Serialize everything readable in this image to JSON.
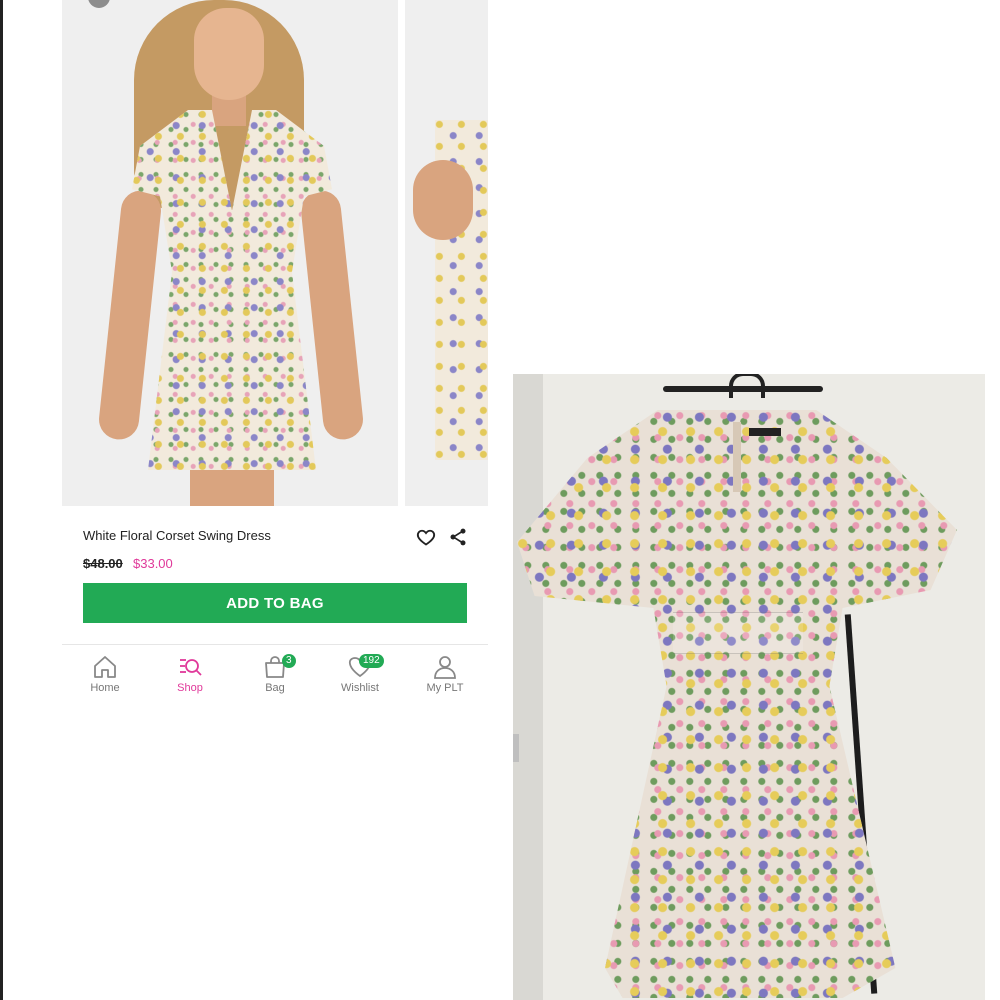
{
  "product": {
    "name": "White Floral Corset Swing Dress",
    "price_original": "$48.00",
    "price_sale": "$33.00",
    "add_to_bag_label": "ADD TO BAG"
  },
  "tabbar": {
    "tabs": [
      {
        "label": "Home",
        "icon": "home-icon"
      },
      {
        "label": "Shop",
        "icon": "shop-icon",
        "active": true
      },
      {
        "label": "Bag",
        "icon": "bag-icon",
        "badge": "3"
      },
      {
        "label": "Wishlist",
        "icon": "heart-icon",
        "badge": "192"
      },
      {
        "label": "My PLT",
        "icon": "user-icon"
      }
    ]
  },
  "colors": {
    "accent_green": "#22aa55",
    "sale_pink": "#e0399a"
  }
}
